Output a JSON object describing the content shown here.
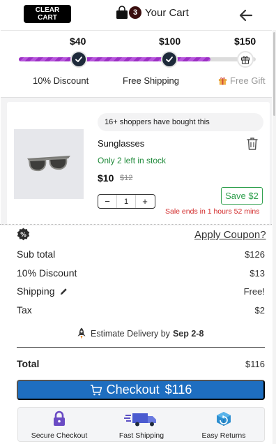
{
  "header": {
    "clear_cart_label": "CLEAR CART",
    "cart_count": "3",
    "title": "Your Cart"
  },
  "progress": {
    "milestones": [
      {
        "amount": "$40",
        "label": "10% Discount"
      },
      {
        "amount": "$100",
        "label": "Free Shipping"
      },
      {
        "amount": "$150",
        "label": "Free Gift"
      }
    ],
    "fill_fraction": 0.81,
    "accent_color": "#9b2fc4"
  },
  "product": {
    "social_proof": "16+ shoppers have bought this",
    "name": "Sunglasses",
    "stock": "Only 2 left in stock",
    "price": "$10",
    "original_price": "$12",
    "quantity": "1",
    "save_label": "Save $2",
    "sale_ends": "Sale ends in 1 hours 52 mins"
  },
  "summary": {
    "apply_coupon": "Apply Coupon?",
    "subtotal_label": "Sub total",
    "subtotal_value": "$126",
    "discount_label": "10% Discount",
    "discount_value": "$13",
    "shipping_label": "Shipping",
    "shipping_value": "Free!",
    "tax_label": "Tax",
    "tax_value": "$2",
    "delivery_prefix": "Estimate Delivery by",
    "delivery_dates": "Sep 2-8",
    "total_label": "Total",
    "total_value": "$116"
  },
  "checkout": {
    "label": "Checkout",
    "amount": "$116",
    "color": "#1e6ec0"
  },
  "features": [
    {
      "label": "Secure Checkout",
      "icon": "lock-icon"
    },
    {
      "label": "Fast Shipping",
      "icon": "truck-icon"
    },
    {
      "label": "Easy Returns",
      "icon": "returns-box-icon"
    }
  ]
}
